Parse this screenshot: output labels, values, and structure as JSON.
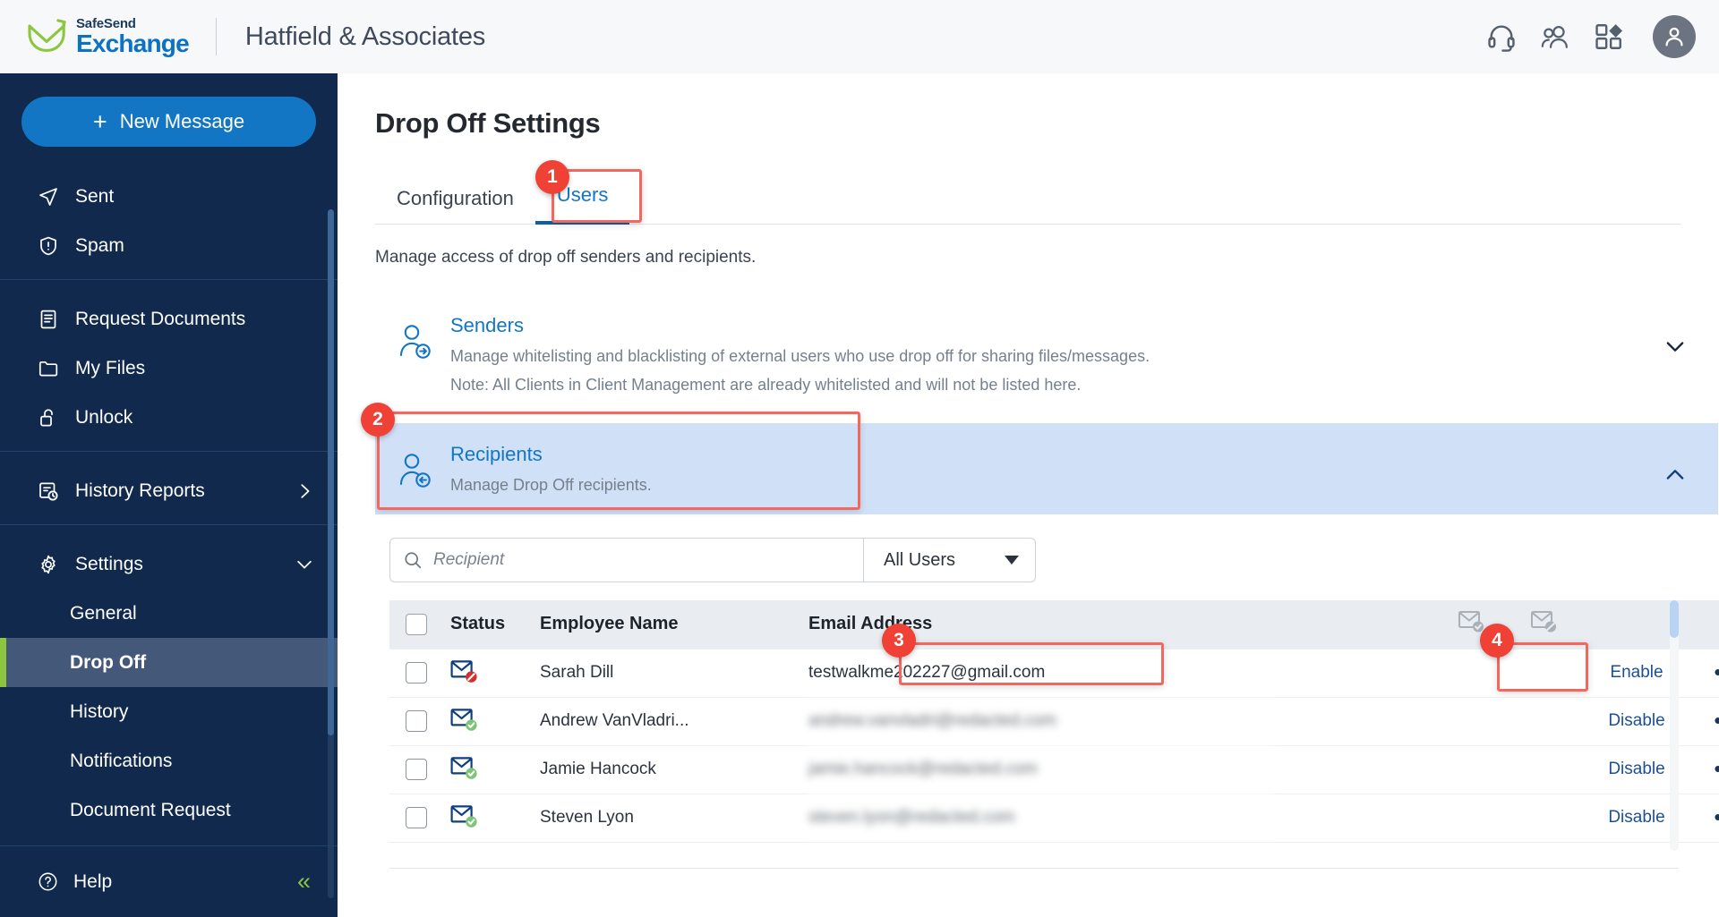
{
  "topbar": {
    "logo_top": "SafeSend",
    "logo_bottom": "Exchange",
    "company": "Hatfield & Associates",
    "icons": [
      {
        "name": "headset-icon",
        "label": "Support"
      },
      {
        "name": "users-icon",
        "label": "Contacts"
      },
      {
        "name": "apps-grid-icon",
        "label": "Apps"
      },
      {
        "name": "avatar-icon",
        "label": "Account"
      }
    ]
  },
  "sidebar": {
    "new_message": "New Message",
    "plus": "+",
    "groups": [
      {
        "items": [
          {
            "label": "Sent",
            "icon": "send-icon"
          },
          {
            "label": "Spam",
            "icon": "shield-alert-icon"
          }
        ]
      },
      {
        "items": [
          {
            "label": "Request Documents",
            "icon": "document-icon"
          },
          {
            "label": "My Files",
            "icon": "folder-icon"
          },
          {
            "label": "Unlock",
            "icon": "unlock-icon"
          }
        ]
      },
      {
        "items": [
          {
            "label": "History Reports",
            "icon": "history-report-icon",
            "chevron": "right"
          }
        ]
      },
      {
        "items": [
          {
            "label": "Settings",
            "icon": "gear-icon",
            "chevron": "down"
          }
        ]
      }
    ],
    "settings_subitems": [
      {
        "label": "General",
        "active": false
      },
      {
        "label": "Drop Off",
        "active": true
      },
      {
        "label": "History",
        "active": false
      },
      {
        "label": "Notifications",
        "active": false
      },
      {
        "label": "Document Request",
        "active": false
      }
    ],
    "help": "Help",
    "collapse": "«",
    "accent_color": "#8cc63f",
    "active_bg": "#44587a"
  },
  "main": {
    "page_title": "Drop Off Settings",
    "tabs": [
      {
        "label": "Configuration",
        "active": false
      },
      {
        "label": "Users",
        "active": true
      }
    ],
    "description": "Manage access of drop off senders and recipients.",
    "panels": [
      {
        "title": "Senders",
        "lines": [
          "Manage whitelisting and blacklisting of external users who use drop off for sharing files/messages.",
          "Note: All Clients in Client Management are already whitelisted and will not be listed here."
        ],
        "expanded": false,
        "chevron": "down",
        "icon": "user-add-icon"
      },
      {
        "title": "Recipients",
        "lines": [
          "Manage Drop Off recipients."
        ],
        "expanded": true,
        "chevron": "up",
        "icon": "user-receive-icon"
      }
    ],
    "search": {
      "placeholder": "Recipient",
      "value": ""
    },
    "filter": {
      "selected": "All Users"
    },
    "table": {
      "columns": [
        {
          "key": "check",
          "label": ""
        },
        {
          "key": "status",
          "label": "Status"
        },
        {
          "key": "name",
          "label": "Employee Name"
        },
        {
          "key": "email",
          "label": "Email Address"
        },
        {
          "key": "grow",
          "label": ""
        },
        {
          "key": "ic1",
          "label": "",
          "icon": "envelope-check-icon"
        },
        {
          "key": "ic2",
          "label": "",
          "icon": "envelope-block-icon"
        },
        {
          "key": "action",
          "label": ""
        },
        {
          "key": "dots",
          "label": ""
        }
      ],
      "rows": [
        {
          "status": "blocked",
          "name": "Sarah Dill",
          "email": "testwalkme202227@gmail.com",
          "email_blurred": false,
          "action": "Enable",
          "menu": "•••"
        },
        {
          "status": "allowed",
          "name": "Andrew VanVladri...",
          "email": "andrew.vanvladri@redacted.com",
          "email_blurred": true,
          "action": "Disable",
          "menu": "•••"
        },
        {
          "status": "allowed",
          "name": "Jamie Hancock",
          "email": "jamie.hancock@redacted.com",
          "email_blurred": true,
          "action": "Disable",
          "menu": "•••"
        },
        {
          "status": "allowed",
          "name": "Steven Lyon",
          "email": "steven.lyon@redacted.com",
          "email_blurred": true,
          "action": "Disable",
          "menu": "•••"
        }
      ]
    }
  },
  "annotations": [
    {
      "number": "1",
      "target": "users-tab"
    },
    {
      "number": "2",
      "target": "recipients-panel"
    },
    {
      "number": "3",
      "target": "recipient-email-cell"
    },
    {
      "number": "4",
      "target": "enable-link"
    }
  ],
  "colors": {
    "brand_blue": "#0b72c4",
    "sidebar_bg": "#10294d",
    "accent_green": "#8cc63f",
    "annotation_red": "#ef4136",
    "panel_highlight": "#cfe0f7"
  }
}
